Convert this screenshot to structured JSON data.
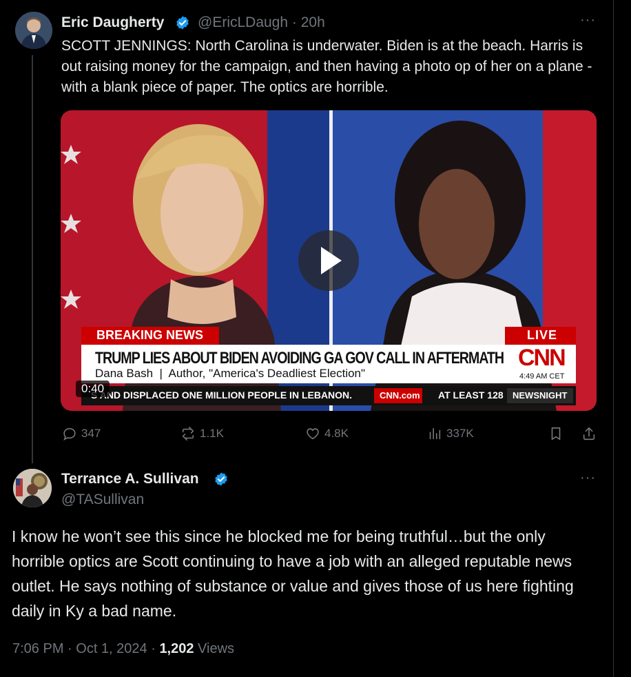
{
  "tweet1": {
    "name": "Eric Daugherty",
    "handle_time": "@EricLDaugh · 20h",
    "text": "SCOTT JENNINGS: North Carolina is underwater. Biden is at the beach. Harris is out raising money for the campaign, and then having a photo op of her on a plane - with a blank piece of paper. The optics are horrible.",
    "more_icon": "ellipsis-icon"
  },
  "video": {
    "breaking_news": "BREAKING NEWS",
    "live": "LIVE",
    "headline": "TRUMP LIES ABOUT BIDEN AVOIDING GA GOV CALL IN AFTERMATH",
    "cnn_logo": "CNN",
    "subline": "Dana Bash  |  Author, \"America's Deadliest Election\"",
    "time": "4:49 AM CET",
    "ticker": "S AND DISPLACED ONE MILLION PEOPLE IN LEBANON.",
    "ticker_site": "CNN.com",
    "ticker_right": "AT LEAST 128",
    "newsnight": "NEWSNIGHT",
    "duration": "0:40"
  },
  "actions": {
    "replies": "347",
    "reposts": "1.1K",
    "likes": "4.8K",
    "views": "337K"
  },
  "tweet2": {
    "name": "Terrance A. Sullivan",
    "handle": "@TASullivan",
    "text": "I know he won’t see this since he blocked me for being truthful…but the only horrible optics are Scott continuing to have a job with an alleged reputable news outlet. He says nothing of substance or value and gives those of us here fighting daily in Ky a bad name."
  },
  "meta": {
    "timestamp": "7:06 PM · Oct 1, 2024 · ",
    "views_count": "1,202",
    "views_label": " Views"
  },
  "colors": {
    "verified": "#1d9bf0",
    "cnn_red": "#cc0000",
    "muted": "#71767b"
  }
}
